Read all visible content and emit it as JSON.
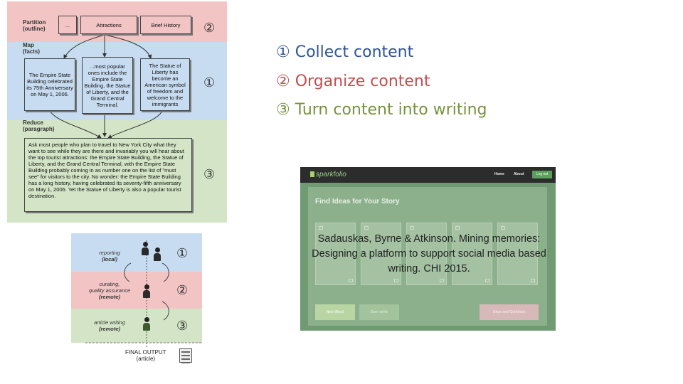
{
  "figure_mapreduce": {
    "partition_label": [
      "Partition",
      "(outline)"
    ],
    "map_label": [
      "Map",
      "(facts)"
    ],
    "reduce_label": [
      "Reduce",
      "(paragraph)"
    ],
    "partition_nodes": [
      "...",
      "Attractions",
      "Brief History"
    ],
    "map_nodes": [
      "The Empire State Building celebrated its 75th Anniversary on May 1, 2006.",
      "...most popular ones include the Empire State Building, the Statue of Liberty, and the Grand Central Terminal.",
      "The Statue of Liberty has become an American symbol of freedom and welcome to the immigrants"
    ],
    "reduce_text": "Ask most people who plan to travel to New York City what they want to see while they are there and invariably you will hear about the top tourist attractions: the Empire State Building, the Statue of Liberty, and the Grand Central Terminal, with the Empire State Building probably coming in as number one on the list of \"must see\" for visitors to the city. No wonder: the Empire State Building has a long history, having celebrated its seventy-fifth anniversary on May 1, 2006. Yet the Statue of Liberty is also a popular tourist destination.",
    "step_markers": [
      "②",
      "①",
      "③"
    ]
  },
  "figure_workflow": {
    "stages": [
      {
        "line1": "reporting",
        "line2": "(local)"
      },
      {
        "line1": "curating,",
        "line2": "quality assurance",
        "line3": "(remote)"
      },
      {
        "line1": "article writing",
        "line2": "(remote)"
      }
    ],
    "markers": [
      "①",
      "②",
      "③"
    ],
    "final_output": "FINAL OUTPUT",
    "final_sub": "(article)"
  },
  "steps": [
    {
      "text": "① Collect content",
      "color": "#2f5597"
    },
    {
      "text": "② Organize content",
      "color": "#c0504d"
    },
    {
      "text": "③ Turn content into writing",
      "color": "#77933c"
    }
  ],
  "sparkfolio": {
    "logo": "sparkfolio",
    "nav": [
      "Home",
      "About"
    ],
    "login": "Log out",
    "panel_title": "Find Ideas for Your Story",
    "buttons": [
      "New Word",
      "Start write",
      "Save and Continue"
    ]
  },
  "citation": "Sadauskas, Byrne & Atkinson. Mining memories: Designing a platform to support social media based writing. CHI 2015."
}
